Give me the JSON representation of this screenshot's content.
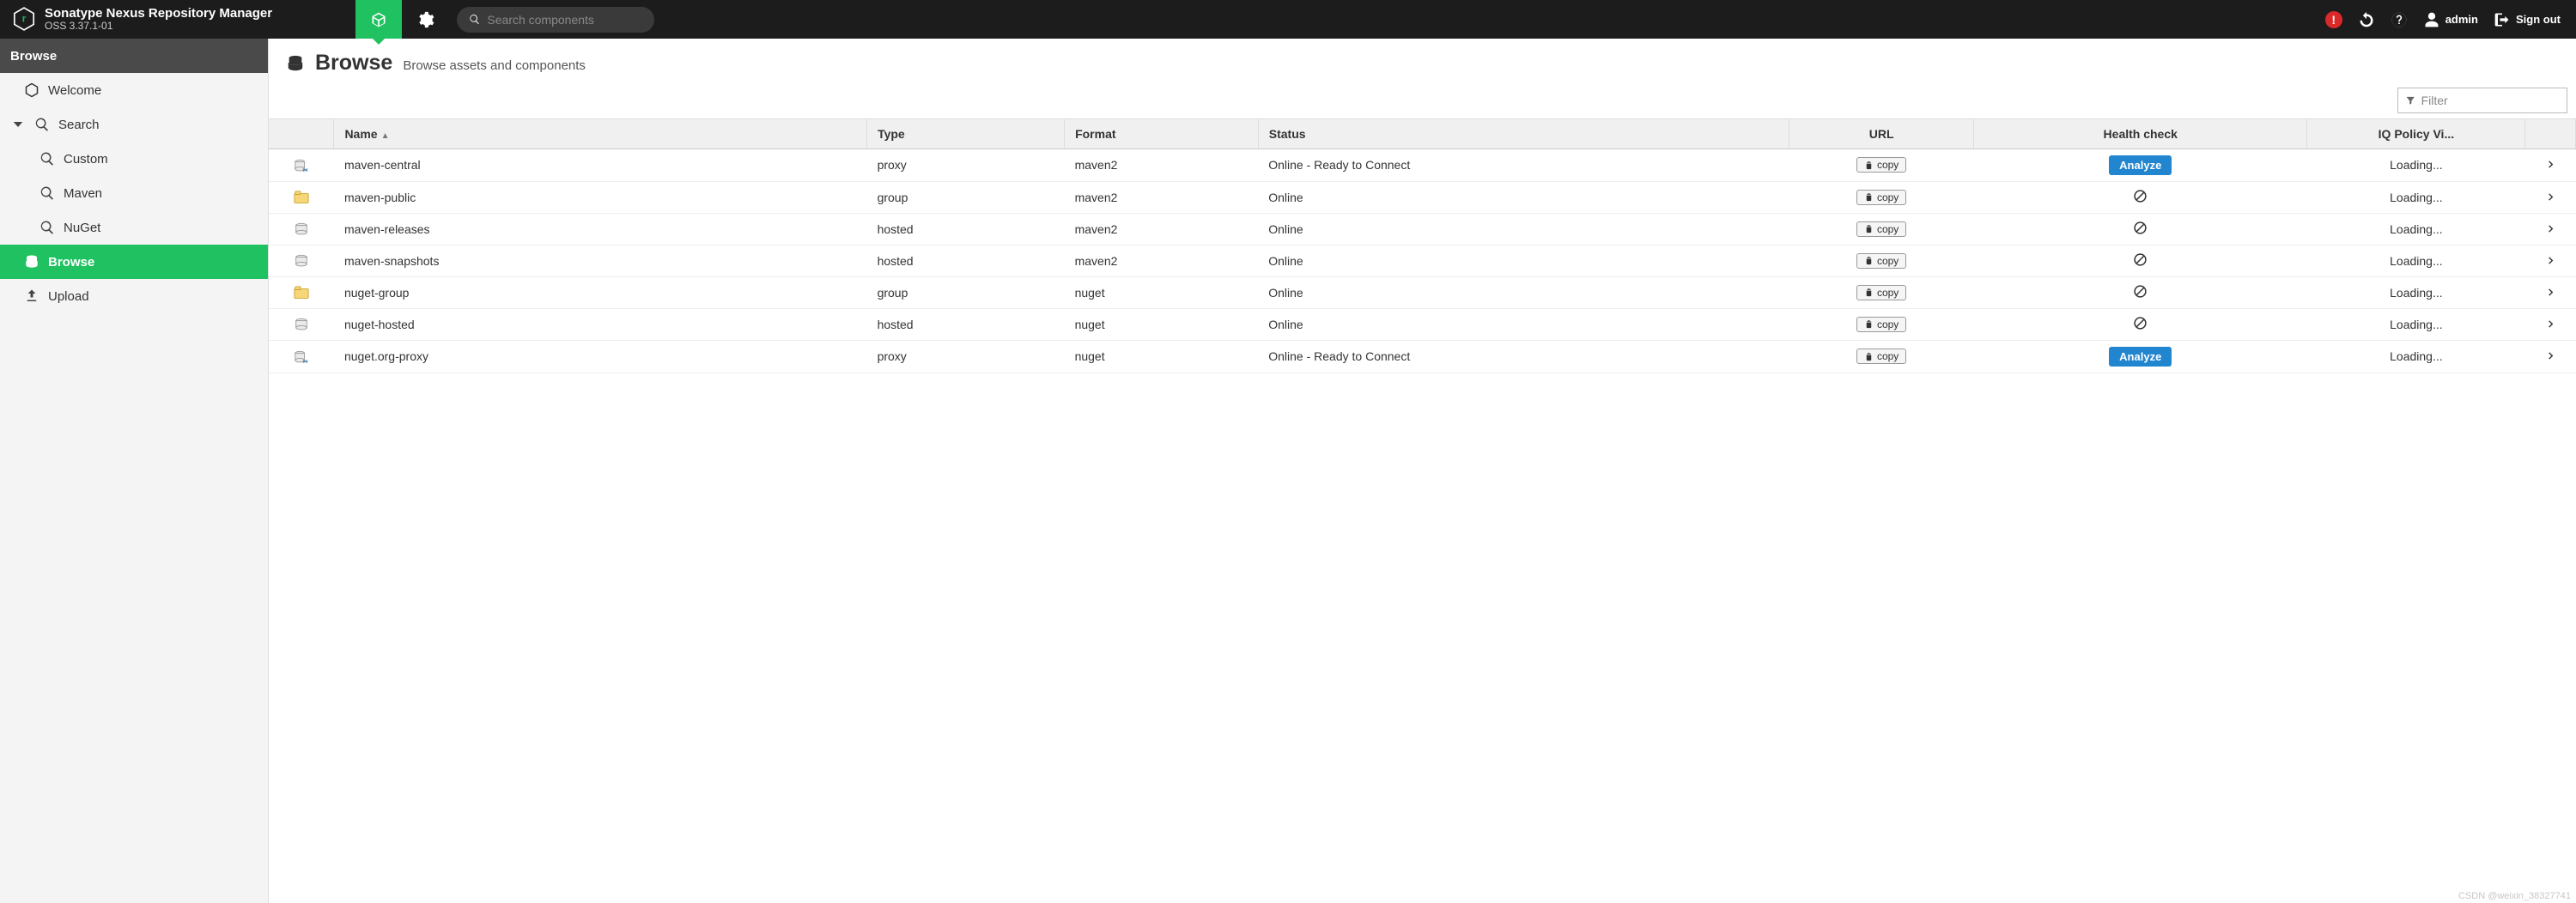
{
  "product": {
    "title": "Sonatype Nexus Repository Manager",
    "version": "OSS 3.37.1-01"
  },
  "header": {
    "search_placeholder": "Search components",
    "username": "admin",
    "signout": "Sign out"
  },
  "sidebar": {
    "header": "Browse",
    "items": [
      {
        "id": "welcome",
        "label": "Welcome",
        "icon": "hexagon",
        "level": 1
      },
      {
        "id": "search",
        "label": "Search",
        "icon": "search",
        "level": 0,
        "expandable": true,
        "expanded": true
      },
      {
        "id": "custom",
        "label": "Custom",
        "icon": "search",
        "level": 2
      },
      {
        "id": "maven",
        "label": "Maven",
        "icon": "search",
        "level": 2
      },
      {
        "id": "nuget",
        "label": "NuGet",
        "icon": "search",
        "level": 2
      },
      {
        "id": "browse",
        "label": "Browse",
        "icon": "database",
        "level": 1,
        "active": true
      },
      {
        "id": "upload",
        "label": "Upload",
        "icon": "upload",
        "level": 1
      }
    ]
  },
  "page": {
    "title": "Browse",
    "subtitle": "Browse assets and components"
  },
  "table": {
    "filter_placeholder": "Filter",
    "columns": {
      "name": "Name",
      "type": "Type",
      "format": "Format",
      "status": "Status",
      "url": "URL",
      "health": "Health check",
      "iq": "IQ Policy Vi..."
    },
    "copy_label": "copy",
    "analyze_label": "Analyze",
    "rows": [
      {
        "icon": "proxy",
        "name": "maven-central",
        "type": "proxy",
        "format": "maven2",
        "status": "Online - Ready to Connect",
        "health": "analyze",
        "iq": "Loading..."
      },
      {
        "icon": "group",
        "name": "maven-public",
        "type": "group",
        "format": "maven2",
        "status": "Online",
        "health": "na",
        "iq": "Loading..."
      },
      {
        "icon": "hosted",
        "name": "maven-releases",
        "type": "hosted",
        "format": "maven2",
        "status": "Online",
        "health": "na",
        "iq": "Loading..."
      },
      {
        "icon": "hosted",
        "name": "maven-snapshots",
        "type": "hosted",
        "format": "maven2",
        "status": "Online",
        "health": "na",
        "iq": "Loading..."
      },
      {
        "icon": "group",
        "name": "nuget-group",
        "type": "group",
        "format": "nuget",
        "status": "Online",
        "health": "na",
        "iq": "Loading..."
      },
      {
        "icon": "hosted",
        "name": "nuget-hosted",
        "type": "hosted",
        "format": "nuget",
        "status": "Online",
        "health": "na",
        "iq": "Loading..."
      },
      {
        "icon": "proxy",
        "name": "nuget.org-proxy",
        "type": "proxy",
        "format": "nuget",
        "status": "Online - Ready to Connect",
        "health": "analyze",
        "iq": "Loading..."
      }
    ]
  },
  "watermark": "CSDN @weixin_38327741"
}
